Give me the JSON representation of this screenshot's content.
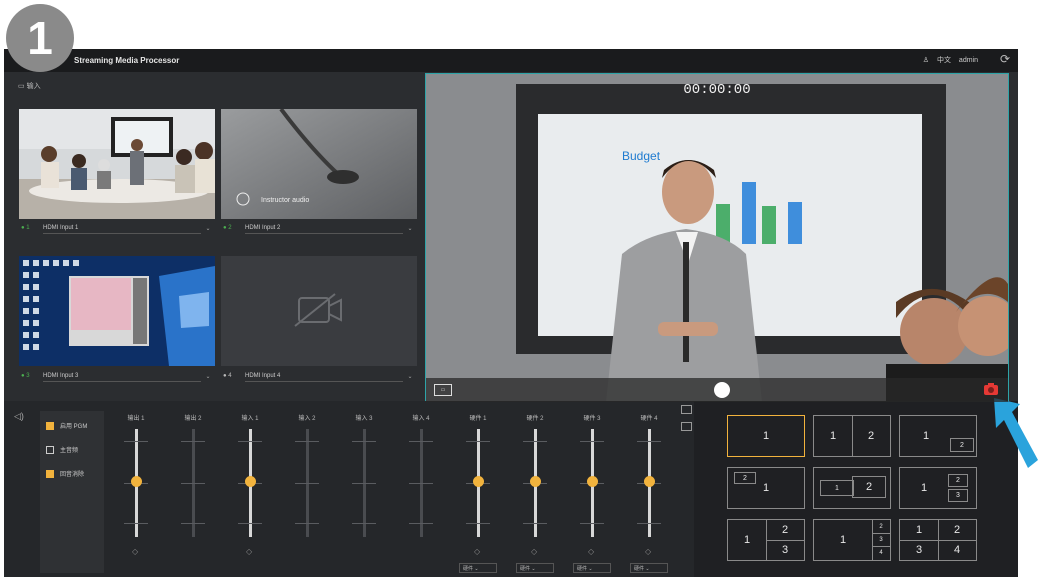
{
  "step": "1",
  "titlebar": {
    "title": "Streaming Media Processor",
    "user_label": "admin",
    "lang": "中文"
  },
  "inputs": {
    "header": "输入",
    "sources": [
      {
        "num": "1",
        "name": "HDMI Input 1"
      },
      {
        "num": "2",
        "name": "HDMI Input 2",
        "overlay": "Instructor audio"
      },
      {
        "num": "3",
        "name": "HDMI Input 3"
      },
      {
        "num": "4",
        "name": "HDMI Input 4"
      }
    ]
  },
  "preview": {
    "timecode": "00:00:00",
    "screen_title": "Budget"
  },
  "audio": {
    "options": [
      {
        "label": "启用 PGM",
        "checked": true
      },
      {
        "label": "主音频",
        "checked": false
      },
      {
        "label": "回音消除",
        "checked": true
      }
    ],
    "channels": [
      {
        "label": "输出 1",
        "active": true,
        "level": 0.52
      },
      {
        "label": "输出 2",
        "active": false
      },
      {
        "label": "输入 1",
        "active": true,
        "level": 0.52
      },
      {
        "label": "输入 2",
        "active": false
      },
      {
        "label": "输入 3",
        "active": false
      },
      {
        "label": "输入 4",
        "active": false
      },
      {
        "label": "硬件 1",
        "active": true,
        "level": 0.52,
        "select": "硬件"
      },
      {
        "label": "硬件 2",
        "active": true,
        "level": 0.52,
        "select": "硬件"
      },
      {
        "label": "硬件 3",
        "active": true,
        "level": 0.52,
        "select": "硬件"
      },
      {
        "label": "硬件 4",
        "active": true,
        "level": 0.52,
        "select": "硬件"
      }
    ]
  },
  "layouts": [
    {
      "labels": [
        "1"
      ]
    },
    {
      "labels": [
        "1",
        "2"
      ]
    },
    {
      "labels": [
        "1",
        "2"
      ]
    },
    {
      "labels": [
        "2",
        "1"
      ]
    },
    {
      "labels": [
        "1",
        "2"
      ]
    },
    {
      "labels": [
        "1",
        "2",
        "3"
      ]
    },
    {
      "labels": [
        "1",
        "2",
        "3"
      ]
    },
    {
      "labels": [
        "1",
        "2",
        "3",
        "4"
      ]
    },
    {
      "labels": [
        "1",
        "2",
        "3",
        "4"
      ]
    }
  ],
  "colors": {
    "accent": "#f2b33d",
    "active_green": "#4caf50",
    "highlight_arrow": "#2aa3dc",
    "record_red": "#e53935"
  }
}
